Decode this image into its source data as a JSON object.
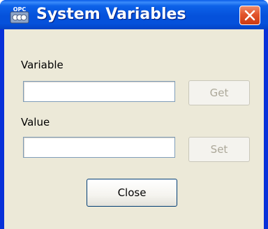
{
  "window": {
    "title": "System Variables",
    "app_icon": "opc-app-icon",
    "app_icon_text": "OPC",
    "close_icon": "close-icon"
  },
  "form": {
    "variable_label": "Variable",
    "variable_value": "",
    "get_button": "Get",
    "value_label": "Value",
    "value_value": "",
    "set_button": "Set",
    "close_button": "Close"
  },
  "colors": {
    "titlebar": "#0551db",
    "dialog_face": "#ece9d8",
    "close_button": "#e2542c",
    "disabled_text": "#aca899"
  }
}
